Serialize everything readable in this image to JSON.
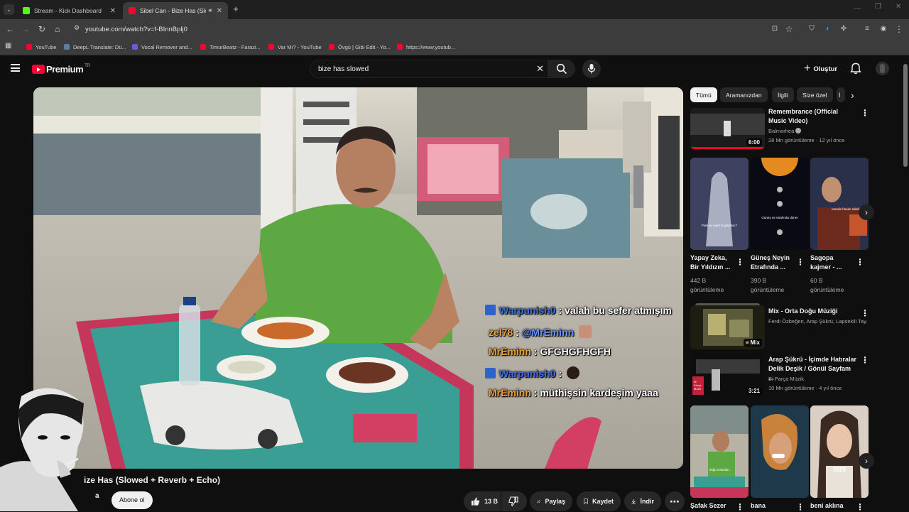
{
  "browser": {
    "tabs": [
      {
        "title": "Stream - Kick Dashboard",
        "active": false,
        "favicon_color": "#53fc18"
      },
      {
        "title": "Sibel Can - Bize Has (Slowe",
        "active": true,
        "favicon_color": "#ff0033"
      }
    ],
    "new_tab_symbol": "+",
    "url": "youtube.com/watch?v=f-BInnBplj0",
    "bookmarks": [
      {
        "label": "YouTube",
        "color": "#ff0033"
      },
      {
        "label": "DeepL Translate: Dü...",
        "color": "#0f2b46"
      },
      {
        "label": "Vocal Remover and...",
        "color": "#6b5bd6"
      },
      {
        "label": "TimurBeatz - Farazi...",
        "color": "#ff0033"
      },
      {
        "label": "Var Mı? - YouTube",
        "color": "#ff0033"
      },
      {
        "label": "Övgü | Gibi Edit - Yo...",
        "color": "#ff0033"
      },
      {
        "label": "https://www.youtub...",
        "color": "#ff0033"
      }
    ]
  },
  "youtube": {
    "logo_text": "Premium",
    "logo_badge": "TR",
    "search_value": "bize has slowed",
    "create_label": "Oluştur"
  },
  "chips": [
    "Tümü",
    "Aramanızdan",
    "İlgili",
    "Size özel",
    "İ"
  ],
  "video": {
    "title": "ize Has (Slowed + Reverb + Echo)",
    "channel_fragment": "a",
    "subscribe_label": "Abone ol",
    "likes": "13 B",
    "share_label": "Paylaş",
    "save_label": "Kaydet",
    "download_label": "İndir"
  },
  "chat": [
    {
      "user": "Warpunish0",
      "message": ": valah bu sefer atmışım",
      "user_color": "#3d6fd6",
      "icon": "hammer"
    },
    {
      "user": "zel78",
      "message": ":",
      "mention": "@MrEminn",
      "user_color": "#e8a33a",
      "icon": ""
    },
    {
      "user": "MrEminn",
      "message": ": GFGHGFHGFH",
      "user_color": "#e8a33a",
      "icon": ""
    },
    {
      "user": "Warpunish0",
      "message": ":",
      "user_color": "#3d6fd6",
      "icon": "hammer"
    },
    {
      "user": "MrEminn",
      "message": ": müthişsin kardeşim yaaa",
      "user_color": "#e8a33a",
      "icon": ""
    }
  ],
  "related": {
    "video1": {
      "title": "Remembrance (Official Music Video)",
      "channel": "Balmorhea",
      "meta": "28 Mn görüntüleme · 12 yıl önce",
      "duration": "6:00"
    },
    "shorts1": [
      {
        "title": "Yapay Zeka, Bir Yıldızın ...",
        "views": "442 B görüntüleme",
        "overlay": "Peki bu nasıl koydukları?"
      },
      {
        "title": "Güneş Neyin Etrafında ...",
        "views": "390 B görüntüleme",
        "overlay": "Güneş ne etrafında döner"
      },
      {
        "title": "Sagopa kajmer - ...",
        "views": "60 B görüntüleme",
        "overlay": "nerede hasan sabah"
      }
    ],
    "mix": {
      "title": "Mix - Orta Doğu Müziği",
      "channels": "Ferdi Özbeğen, Arap Şükrü, Lapsekili Tay...",
      "badge": "Mix"
    },
    "video2": {
      "title": "Arap Şükrü - İçimde Hatıralar Delik Deşik / Gönül Sayfam ...",
      "channel": "Bi Parça Müzik",
      "meta": "10 Mn görüntüleme · 4 yıl önce",
      "duration": "3:21",
      "thumb_text": "Bi Parça Müzik"
    },
    "shorts2": [
      {
        "title": "Şafak Sezer",
        "overlay": "doğu insanları"
      },
      {
        "title": "bana",
        "overlay": ""
      },
      {
        "title": "beni aklına",
        "overlay": "2025"
      }
    ]
  }
}
